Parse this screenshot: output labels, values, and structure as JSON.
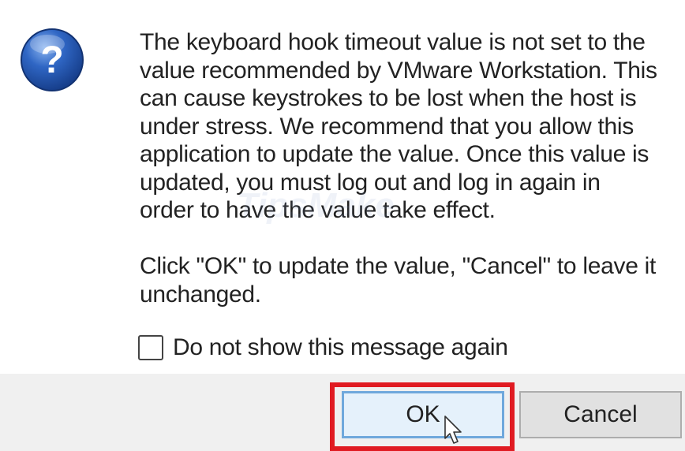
{
  "dialog": {
    "icon": "question-icon",
    "message_lines": [
      "The keyboard hook timeout value is not set to the",
      "value recommended by VMware Workstation. This",
      "can cause keystrokes to be lost when the host is",
      "under stress. We recommend that you allow this",
      "application to update the value.  Once this value is",
      "updated, you must log out and log in again in",
      "order to have the value take effect."
    ],
    "prompt_lines": [
      "Click \"OK\" to update the value, \"Cancel\" to leave it",
      "unchanged."
    ],
    "checkbox": {
      "label": "Do not show this message again",
      "checked": false
    },
    "buttons": {
      "ok_label": "OK",
      "cancel_label": "Cancel"
    },
    "watermark": "TipsMake"
  },
  "colors": {
    "highlight": "#e01b22",
    "ok_border": "#6fa8dc",
    "ok_background": "#e5f1fb",
    "icon_blue": "#1e4fa8"
  }
}
